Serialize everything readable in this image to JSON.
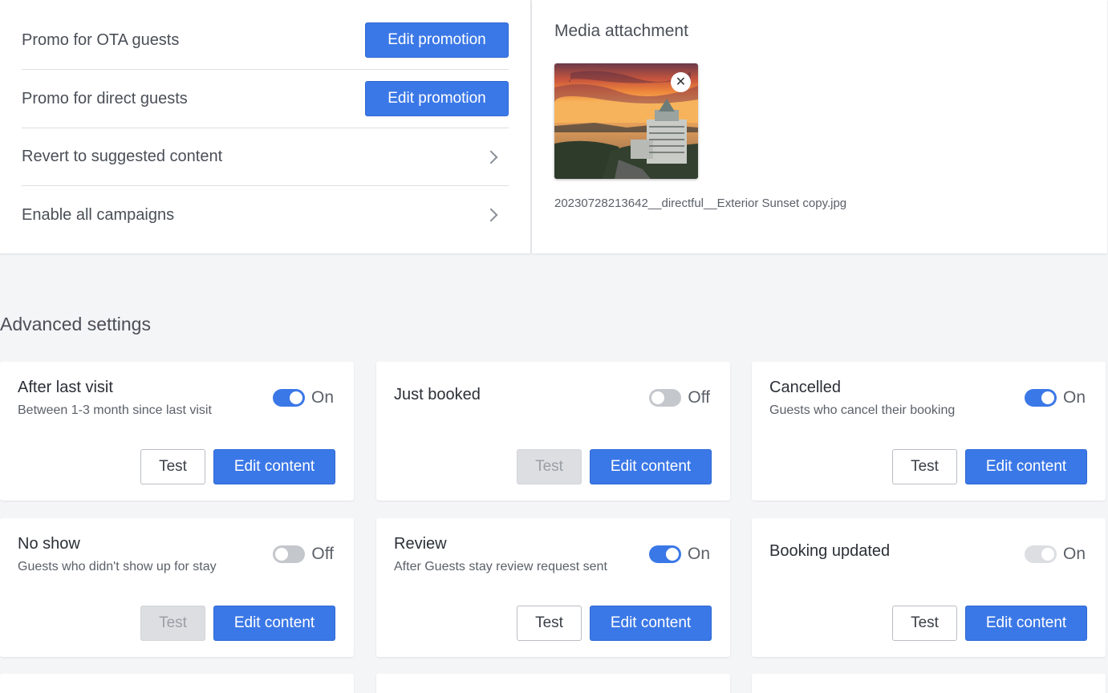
{
  "promotions": {
    "rows": [
      {
        "label": "Promo for OTA guests",
        "button": "Edit promotion"
      },
      {
        "label": "Promo for direct guests",
        "button": "Edit promotion"
      },
      {
        "label": "Revert to suggested content"
      },
      {
        "label": "Enable all campaigns"
      }
    ]
  },
  "media": {
    "title": "Media attachment",
    "close_glyph": "✕",
    "filename": "20230728213642__directful__Exterior Sunset copy.jpg"
  },
  "advanced": {
    "title": "Advanced settings",
    "cards": [
      {
        "title": "After last visit",
        "subtitle": "Between 1-3 month since last visit",
        "toggle": "On",
        "state": "on",
        "test": "Test",
        "test_disabled": false,
        "edit": "Edit content"
      },
      {
        "title": "Just booked",
        "subtitle": "",
        "toggle": "Off",
        "state": "off",
        "test": "Test",
        "test_disabled": true,
        "edit": "Edit content"
      },
      {
        "title": "Cancelled",
        "subtitle": "Guests who cancel their booking",
        "toggle": "On",
        "state": "on",
        "test": "Test",
        "test_disabled": false,
        "edit": "Edit content"
      },
      {
        "title": "No show",
        "subtitle": "Guests who didn't show up for stay",
        "toggle": "Off",
        "state": "off",
        "test": "Test",
        "test_disabled": true,
        "edit": "Edit content"
      },
      {
        "title": "Review",
        "subtitle": "After Guests stay review request sent",
        "toggle": "On",
        "state": "on",
        "test": "Test",
        "test_disabled": false,
        "edit": "Edit content"
      },
      {
        "title": "Booking updated",
        "subtitle": "",
        "toggle": "On",
        "state": "disabled-on",
        "test": "Test",
        "test_disabled": false,
        "edit": "Edit content"
      }
    ]
  },
  "colors": {
    "primary": "#3b78e7",
    "background": "#f4f5f7",
    "toggle_off": "#c4c7cc"
  }
}
